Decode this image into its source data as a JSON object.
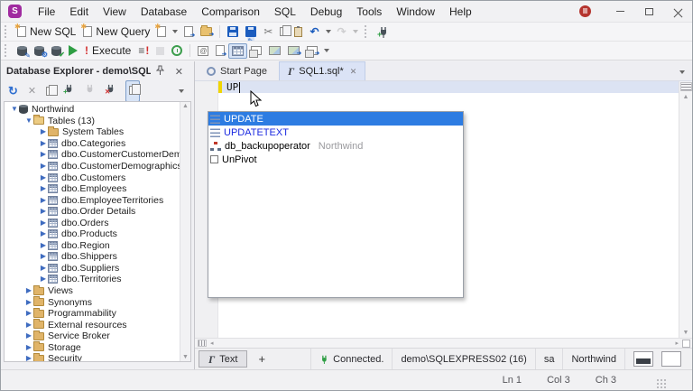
{
  "titlebar": {
    "logo_letter": "S",
    "menus": [
      "File",
      "Edit",
      "View",
      "Database",
      "Comparison",
      "SQL",
      "Debug",
      "Tools",
      "Window",
      "Help"
    ]
  },
  "toolbar_standard": {
    "new_sql": "New SQL",
    "new_query": "New Query"
  },
  "toolbar_execute": {
    "execute": "Execute"
  },
  "explorer": {
    "title": "Database Explorer - demo\\SQLEX...",
    "tree": [
      {
        "label": "Northwind",
        "icon": "database",
        "arrow": "expanded",
        "level": 0
      },
      {
        "label": "Tables (13)",
        "icon": "folder-open",
        "arrow": "expanded",
        "level": 1
      },
      {
        "label": "System Tables",
        "icon": "folder",
        "arrow": "collapsed",
        "level": 2
      },
      {
        "label": "dbo.Categories",
        "icon": "table",
        "arrow": "collapsed",
        "level": 2
      },
      {
        "label": "dbo.CustomerCustomerDemo",
        "icon": "table",
        "arrow": "collapsed",
        "level": 2
      },
      {
        "label": "dbo.CustomerDemographics",
        "icon": "table",
        "arrow": "collapsed",
        "level": 2
      },
      {
        "label": "dbo.Customers",
        "icon": "table",
        "arrow": "collapsed",
        "level": 2
      },
      {
        "label": "dbo.Employees",
        "icon": "table",
        "arrow": "collapsed",
        "level": 2
      },
      {
        "label": "dbo.EmployeeTerritories",
        "icon": "table",
        "arrow": "collapsed",
        "level": 2
      },
      {
        "label": "dbo.Order Details",
        "icon": "table",
        "arrow": "collapsed",
        "level": 2
      },
      {
        "label": "dbo.Orders",
        "icon": "table",
        "arrow": "collapsed",
        "level": 2
      },
      {
        "label": "dbo.Products",
        "icon": "table",
        "arrow": "collapsed",
        "level": 2
      },
      {
        "label": "dbo.Region",
        "icon": "table",
        "arrow": "collapsed",
        "level": 2
      },
      {
        "label": "dbo.Shippers",
        "icon": "table",
        "arrow": "collapsed",
        "level": 2
      },
      {
        "label": "dbo.Suppliers",
        "icon": "table",
        "arrow": "collapsed",
        "level": 2
      },
      {
        "label": "dbo.Territories",
        "icon": "table",
        "arrow": "collapsed",
        "level": 2
      },
      {
        "label": "Views",
        "icon": "folder",
        "arrow": "collapsed",
        "level": 1
      },
      {
        "label": "Synonyms",
        "icon": "folder",
        "arrow": "collapsed",
        "level": 1
      },
      {
        "label": "Programmability",
        "icon": "folder",
        "arrow": "collapsed",
        "level": 1
      },
      {
        "label": "External resources",
        "icon": "folder",
        "arrow": "collapsed",
        "level": 1
      },
      {
        "label": "Service Broker",
        "icon": "folder",
        "arrow": "collapsed",
        "level": 1
      },
      {
        "label": "Storage",
        "icon": "folder",
        "arrow": "collapsed",
        "level": 1
      },
      {
        "label": "Security",
        "icon": "folder",
        "arrow": "collapsed",
        "level": 1
      }
    ]
  },
  "tabs": [
    {
      "label": "Start Page",
      "icon": "start-page",
      "active": false,
      "closable": false
    },
    {
      "label": "SQL1.sql*",
      "icon": "sql-doc",
      "active": true,
      "closable": true
    }
  ],
  "editor": {
    "line1": "UP"
  },
  "completion": {
    "items": [
      {
        "label": "UPDATE",
        "kind": "keyword",
        "selected": true
      },
      {
        "label": "UPDATETEXT",
        "kind": "keyword",
        "selected": false
      },
      {
        "label": "db_backupoperator",
        "suffix": "Northwind",
        "kind": "role",
        "selected": false
      },
      {
        "label": "UnPivot",
        "kind": "snippet",
        "selected": false
      }
    ]
  },
  "docbar": {
    "text_tab": "Text",
    "new_tab": "+",
    "connection_status": "Connected.",
    "server": "demo\\SQLEXPRESS02 (16)",
    "user": "sa",
    "database": "Northwind"
  },
  "statusbar": {
    "line": "Ln 1",
    "column": "Col 3",
    "char": "Ch 3"
  },
  "colors": {
    "accent_blue": "#2d7ce2",
    "keyword_blue": "#1b2ae0",
    "active_tab": "#dbe3f6",
    "modified_marker": "#f0d500",
    "logo_purple": "#a02ba0",
    "connected_green": "#2f9e44"
  }
}
